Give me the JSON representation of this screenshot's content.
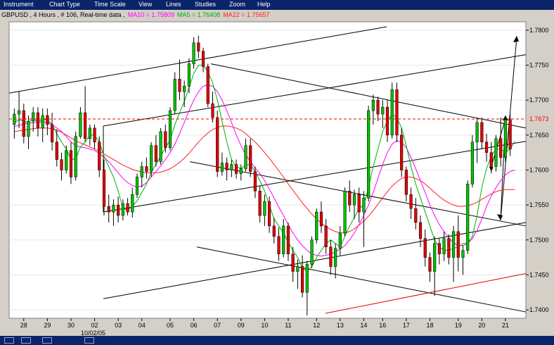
{
  "menu": [
    "Instrument",
    "Chart Type",
    "Time Scale",
    "View",
    "Lines",
    "Studies",
    "Zoom",
    "Help"
  ],
  "header": {
    "info": "GBPUSD  , 4 Hours , # 106, Real-time data  ,",
    "ma10": "MA10 = 1.75809",
    "ma5": "MA5 = 1.76408",
    "ma22": "MA22 = 1.75657"
  },
  "colors": {
    "up": "#00c000",
    "down": "#e00000",
    "ma5": "#00b000",
    "ma10": "#ff00ff",
    "ma22": "#ff2020",
    "background": "#ffffff",
    "frame": "#d4d0c8",
    "menubar": "#0a246a"
  },
  "chart_data": {
    "type": "candlestick",
    "symbol": "GBPUSD",
    "timeframe": "4 Hours",
    "x_tick_labels": [
      "28",
      "29",
      "30",
      "02",
      "03",
      "04",
      "05",
      "06",
      "07",
      "09",
      "10",
      "11",
      "12",
      "13",
      "14",
      "16",
      "17",
      "18",
      "19",
      "20",
      "21"
    ],
    "x_sublabel": "10/02/05",
    "y_ticks": [
      "1.7800",
      "1.7750",
      "1.7700",
      "1.7650",
      "1.7600",
      "1.7550",
      "1.7500",
      "1.7450",
      "1.7400"
    ],
    "ylim": [
      1.7388,
      1.7812
    ],
    "current_price_label": "1.7673",
    "current_price": 1.7673,
    "candles": [
      [
        1.7665,
        1.7688,
        1.7645,
        1.768
      ],
      [
        1.768,
        1.7712,
        1.766,
        1.7685
      ],
      [
        1.7685,
        1.7695,
        1.7638,
        1.7648
      ],
      [
        1.7648,
        1.7678,
        1.763,
        1.767
      ],
      [
        1.767,
        1.769,
        1.7655,
        1.7682
      ],
      [
        1.7682,
        1.769,
        1.7648,
        1.766
      ],
      [
        1.766,
        1.7688,
        1.764,
        1.7678
      ],
      [
        1.7678,
        1.7688,
        1.765,
        1.7665
      ],
      [
        1.7665,
        1.7682,
        1.7628,
        1.764
      ],
      [
        1.764,
        1.7658,
        1.7605,
        1.7615
      ],
      [
        1.7615,
        1.7625,
        1.7585,
        1.76
      ],
      [
        1.76,
        1.7635,
        1.7595,
        1.7628
      ],
      [
        1.7628,
        1.764,
        1.758,
        1.759
      ],
      [
        1.759,
        1.7655,
        1.7585,
        1.7648
      ],
      [
        1.7648,
        1.769,
        1.7645,
        1.7682
      ],
      [
        1.7682,
        1.772,
        1.764,
        1.7645
      ],
      [
        1.7645,
        1.7665,
        1.7635,
        1.766
      ],
      [
        1.766,
        1.7665,
        1.763,
        1.764
      ],
      [
        1.764,
        1.7648,
        1.759,
        1.76
      ],
      [
        1.76,
        1.7615,
        1.7535,
        1.7548
      ],
      [
        1.7548,
        1.7565,
        1.7525,
        1.754
      ],
      [
        1.754,
        1.7558,
        1.752,
        1.755
      ],
      [
        1.755,
        1.7562,
        1.7525,
        1.7535
      ],
      [
        1.7535,
        1.7558,
        1.7528,
        1.7552
      ],
      [
        1.7552,
        1.756,
        1.7535,
        1.754
      ],
      [
        1.754,
        1.7575,
        1.7532,
        1.7565
      ],
      [
        1.7565,
        1.7595,
        1.756,
        1.759
      ],
      [
        1.759,
        1.7612,
        1.7575,
        1.7605
      ],
      [
        1.7605,
        1.7618,
        1.7588,
        1.7598
      ],
      [
        1.7598,
        1.764,
        1.759,
        1.7635
      ],
      [
        1.7635,
        1.765,
        1.7605,
        1.7612
      ],
      [
        1.7612,
        1.766,
        1.7608,
        1.7655
      ],
      [
        1.7655,
        1.7665,
        1.7625,
        1.7632
      ],
      [
        1.7632,
        1.769,
        1.7628,
        1.7685
      ],
      [
        1.7685,
        1.774,
        1.768,
        1.773
      ],
      [
        1.773,
        1.7758,
        1.77,
        1.7712
      ],
      [
        1.7712,
        1.7728,
        1.769,
        1.772
      ],
      [
        1.772,
        1.776,
        1.771,
        1.7752
      ],
      [
        1.7752,
        1.779,
        1.7745,
        1.7782
      ],
      [
        1.7782,
        1.7792,
        1.776,
        1.777
      ],
      [
        1.777,
        1.7775,
        1.774,
        1.7748
      ],
      [
        1.7748,
        1.7752,
        1.769,
        1.7695
      ],
      [
        1.7695,
        1.7712,
        1.7668,
        1.7675
      ],
      [
        1.7675,
        1.7685,
        1.759,
        1.7598
      ],
      [
        1.7598,
        1.7625,
        1.7592,
        1.761
      ],
      [
        1.761,
        1.7618,
        1.7585,
        1.76
      ],
      [
        1.76,
        1.7615,
        1.759,
        1.7608
      ],
      [
        1.7608,
        1.7615,
        1.7588,
        1.7595
      ],
      [
        1.7595,
        1.7608,
        1.7585,
        1.7602
      ],
      [
        1.7602,
        1.7645,
        1.7598,
        1.7635
      ],
      [
        1.7635,
        1.7645,
        1.759,
        1.7598
      ],
      [
        1.7598,
        1.7605,
        1.756,
        1.757
      ],
      [
        1.757,
        1.7578,
        1.7525,
        1.7535
      ],
      [
        1.7535,
        1.7565,
        1.752,
        1.7555
      ],
      [
        1.7555,
        1.7562,
        1.751,
        1.752
      ],
      [
        1.752,
        1.7532,
        1.7495,
        1.7505
      ],
      [
        1.7505,
        1.7518,
        1.747,
        1.748
      ],
      [
        1.748,
        1.753,
        1.7475,
        1.752
      ],
      [
        1.752,
        1.7525,
        1.747,
        1.748
      ],
      [
        1.748,
        1.749,
        1.744,
        1.7455
      ],
      [
        1.7455,
        1.7472,
        1.743,
        1.7462
      ],
      [
        1.7462,
        1.7478,
        1.7418,
        1.7425
      ],
      [
        1.7425,
        1.747,
        1.7392,
        1.7465
      ],
      [
        1.7465,
        1.7505,
        1.746,
        1.75
      ],
      [
        1.75,
        1.7545,
        1.7495,
        1.754
      ],
      [
        1.754,
        1.7555,
        1.751,
        1.752
      ],
      [
        1.752,
        1.753,
        1.748,
        1.749
      ],
      [
        1.749,
        1.75,
        1.745,
        1.7462
      ],
      [
        1.7462,
        1.7495,
        1.7445,
        1.7488
      ],
      [
        1.7488,
        1.752,
        1.7478,
        1.751
      ],
      [
        1.751,
        1.7575,
        1.7505,
        1.757
      ],
      [
        1.757,
        1.7585,
        1.754,
        1.755
      ],
      [
        1.755,
        1.7572,
        1.753,
        1.7565
      ],
      [
        1.7565,
        1.7575,
        1.7525,
        1.754
      ],
      [
        1.754,
        1.757,
        1.749,
        1.756
      ],
      [
        1.756,
        1.7692,
        1.7555,
        1.7685
      ],
      [
        1.7685,
        1.7708,
        1.7665,
        1.77
      ],
      [
        1.77,
        1.7705,
        1.767,
        1.768
      ],
      [
        1.768,
        1.77,
        1.766,
        1.769
      ],
      [
        1.769,
        1.77,
        1.764,
        1.765
      ],
      [
        1.765,
        1.7725,
        1.7645,
        1.7715
      ],
      [
        1.7715,
        1.7725,
        1.764,
        1.765
      ],
      [
        1.765,
        1.766,
        1.759,
        1.76
      ],
      [
        1.76,
        1.7605,
        1.7555,
        1.7565
      ],
      [
        1.7565,
        1.7575,
        1.753,
        1.7545
      ],
      [
        1.7545,
        1.756,
        1.7515,
        1.7525
      ],
      [
        1.7525,
        1.7535,
        1.749,
        1.7502
      ],
      [
        1.7502,
        1.7515,
        1.7462,
        1.7475
      ],
      [
        1.7475,
        1.7482,
        1.744,
        1.7455
      ],
      [
        1.7455,
        1.7505,
        1.742,
        1.7495
      ],
      [
        1.7495,
        1.7502,
        1.7465,
        1.748
      ],
      [
        1.748,
        1.7512,
        1.747,
        1.7502
      ],
      [
        1.7502,
        1.7508,
        1.7465,
        1.7475
      ],
      [
        1.7475,
        1.752,
        1.744,
        1.7512
      ],
      [
        1.7512,
        1.7535,
        1.7455,
        1.7475
      ],
      [
        1.7475,
        1.7492,
        1.745,
        1.7485
      ],
      [
        1.7485,
        1.7585,
        1.748,
        1.758
      ],
      [
        1.758,
        1.765,
        1.7575,
        1.764
      ],
      [
        1.764,
        1.7675,
        1.761,
        1.7668
      ],
      [
        1.7668,
        1.7675,
        1.763,
        1.764
      ],
      [
        1.764,
        1.7652,
        1.7612,
        1.7625
      ],
      [
        1.7625,
        1.764,
        1.7595,
        1.7605
      ],
      [
        1.7605,
        1.765,
        1.7598,
        1.7645
      ],
      [
        1.7645,
        1.7675,
        1.7605,
        1.7618
      ],
      [
        1.7618,
        1.7678,
        1.7612,
        1.7672
      ],
      [
        1.7672,
        1.768,
        1.762,
        1.763
      ]
    ],
    "ma5": [
      1.7668,
      1.7672,
      1.767,
      1.7668,
      1.7673,
      1.7669,
      1.7672,
      1.7672,
      1.7665,
      1.7652,
      1.764,
      1.763,
      1.7615,
      1.7616,
      1.7633,
      1.764,
      1.765,
      1.765,
      1.764,
      1.762,
      1.7605,
      1.759,
      1.757,
      1.7545,
      1.7543,
      1.7548,
      1.7556,
      1.7568,
      1.758,
      1.7597,
      1.7608,
      1.762,
      1.7632,
      1.7643,
      1.7665,
      1.7682,
      1.7698,
      1.7718,
      1.7738,
      1.775,
      1.775,
      1.774,
      1.7725,
      1.77,
      1.767,
      1.764,
      1.7615,
      1.7605,
      1.7602,
      1.7607,
      1.7608,
      1.7598,
      1.7585,
      1.757,
      1.755,
      1.753,
      1.752,
      1.751,
      1.7497,
      1.7485,
      1.7475,
      1.746,
      1.7455,
      1.7462,
      1.7475,
      1.7485,
      1.7495,
      1.75,
      1.7495,
      1.749,
      1.7505,
      1.752,
      1.7532,
      1.7545,
      1.755,
      1.7575,
      1.7605,
      1.763,
      1.7655,
      1.767,
      1.768,
      1.7675,
      1.766,
      1.7635,
      1.7605,
      1.758,
      1.756,
      1.754,
      1.752,
      1.75,
      1.749,
      1.7485,
      1.7485,
      1.7488,
      1.749,
      1.7495,
      1.7495,
      1.7505,
      1.7535,
      1.7575,
      1.7602,
      1.762,
      1.763,
      1.763,
      1.7625,
      1.763,
      1.7641
    ],
    "ma10": [
      1.7662,
      1.7664,
      1.7666,
      1.7667,
      1.7668,
      1.7668,
      1.7669,
      1.7668,
      1.7665,
      1.766,
      1.7655,
      1.7648,
      1.764,
      1.7635,
      1.7633,
      1.7632,
      1.763,
      1.7628,
      1.7624,
      1.7618,
      1.7612,
      1.7604,
      1.7596,
      1.7588,
      1.7582,
      1.7578,
      1.7576,
      1.7577,
      1.7582,
      1.759,
      1.7598,
      1.7606,
      1.7615,
      1.7625,
      1.7637,
      1.7652,
      1.7668,
      1.7685,
      1.77,
      1.7712,
      1.772,
      1.7722,
      1.772,
      1.7712,
      1.77,
      1.7685,
      1.7668,
      1.765,
      1.7635,
      1.7622,
      1.7612,
      1.7603,
      1.7595,
      1.7585,
      1.7573,
      1.756,
      1.7547,
      1.7535,
      1.7522,
      1.751,
      1.75,
      1.7492,
      1.7485,
      1.748,
      1.7478,
      1.7477,
      1.7478,
      1.748,
      1.7483,
      1.7487,
      1.7492,
      1.75,
      1.751,
      1.7522,
      1.7535,
      1.755,
      1.7568,
      1.7588,
      1.7608,
      1.7625,
      1.7637,
      1.7642,
      1.764,
      1.7632,
      1.7618,
      1.7602,
      1.7585,
      1.7568,
      1.755,
      1.7535,
      1.7522,
      1.7512,
      1.7503,
      1.7496,
      1.7492,
      1.7492,
      1.7495,
      1.7502,
      1.7514,
      1.753,
      1.7548,
      1.7563,
      1.7575,
      1.7585,
      1.7593,
      1.7598,
      1.76
    ],
    "ma22": [
      1.7655,
      1.7656,
      1.7657,
      1.7658,
      1.7659,
      1.766,
      1.766,
      1.766,
      1.7659,
      1.7657,
      1.7654,
      1.765,
      1.7646,
      1.7642,
      1.7639,
      1.7636,
      1.7633,
      1.763,
      1.7627,
      1.7623,
      1.7619,
      1.7615,
      1.7611,
      1.7607,
      1.7604,
      1.7601,
      1.7599,
      1.7597,
      1.7596,
      1.7596,
      1.7596,
      1.7597,
      1.7599,
      1.7602,
      1.7606,
      1.7611,
      1.7617,
      1.7624,
      1.7632,
      1.764,
      1.7647,
      1.7653,
      1.7658,
      1.7661,
      1.7663,
      1.7663,
      1.7662,
      1.766,
      1.7657,
      1.7652,
      1.7646,
      1.764,
      1.7633,
      1.7625,
      1.7617,
      1.7608,
      1.7599,
      1.759,
      1.758,
      1.7571,
      1.7562,
      1.7553,
      1.7545,
      1.7537,
      1.753,
      1.7524,
      1.7519,
      1.7515,
      1.7512,
      1.751,
      1.751,
      1.7512,
      1.7516,
      1.7521,
      1.7527,
      1.7534,
      1.7542,
      1.7551,
      1.756,
      1.7569,
      1.7577,
      1.7583,
      1.7588,
      1.759,
      1.759,
      1.7588,
      1.7585,
      1.758,
      1.7574,
      1.7568,
      1.7562,
      1.7557,
      1.7553,
      1.755,
      1.7548,
      1.7548,
      1.7549,
      1.7551,
      1.7554,
      1.7558,
      1.7562,
      1.7566,
      1.7569,
      1.7571,
      1.7572,
      1.7572,
      1.7572
    ]
  }
}
